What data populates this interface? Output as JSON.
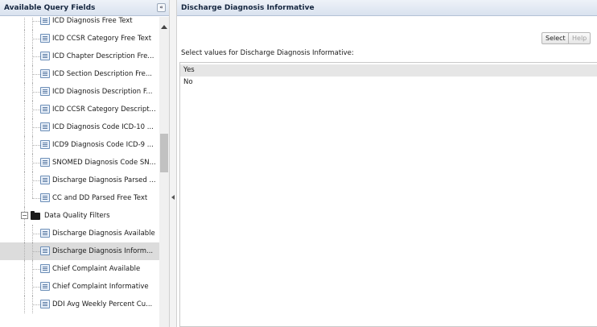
{
  "left_panel": {
    "title": "Available Query Fields",
    "collapse_glyph": "«"
  },
  "tree": {
    "fields": [
      "ICD Diagnosis Free Text",
      "ICD CCSR Category Free Text",
      "ICD Chapter Description Fre...",
      "ICD Section Description Fre...",
      "ICD Diagnosis Description F...",
      "ICD CCSR Category Descript...",
      "ICD Diagnosis Code ICD-10 ...",
      "ICD9 Diagnosis Code ICD-9 ...",
      "SNOMED Diagnosis Code SN...",
      "Discharge Diagnosis Parsed ...",
      "CC and DD Parsed Free Text"
    ],
    "folder": {
      "label": "Data Quality Filters",
      "expand_glyph": "−",
      "icon": "folder-icon"
    },
    "dq_fields": [
      "Discharge Diagnosis Available",
      "Discharge Diagnosis Inform...",
      "Chief Complaint Available",
      "Chief Complaint Informative",
      "DDI Avg Weekly Percent Cu..."
    ],
    "selected_field": "Discharge Diagnosis Inform..."
  },
  "right_panel": {
    "title": "Discharge Diagnosis Informative",
    "select_label": "Select",
    "help_label": "Help",
    "prompt": "Select values for Discharge Diagnosis Informative:",
    "values": [
      "Yes",
      "No"
    ],
    "highlighted_value": "Yes"
  },
  "colors": {
    "header_bg": "#dde5f0",
    "selected_row": "#dcdcdc",
    "highlighted_value": "#e6e6e6"
  }
}
